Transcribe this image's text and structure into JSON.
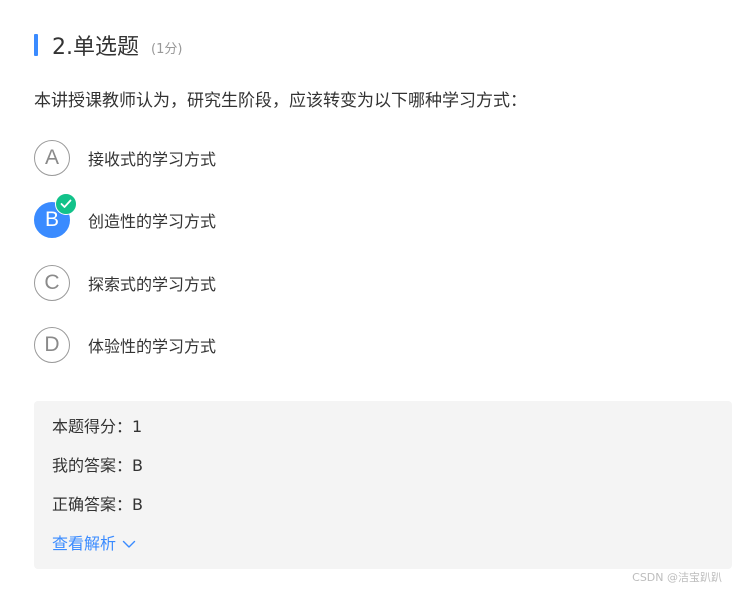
{
  "question": {
    "title": "2.单选题",
    "score": "(1分)",
    "stem": "本讲授课教师认为，研究生阶段，应该转变为以下哪种学习方式：",
    "options": [
      {
        "letter": "A",
        "text": "接收式的学习方式",
        "selected": false
      },
      {
        "letter": "B",
        "text": "创造性的学习方式",
        "selected": true
      },
      {
        "letter": "C",
        "text": "探索式的学习方式",
        "selected": false
      },
      {
        "letter": "D",
        "text": "体验性的学习方式",
        "selected": false
      }
    ]
  },
  "result": {
    "score_line": "本题得分：1",
    "my_answer_line": "我的答案：B",
    "correct_answer_line": "正确答案：B",
    "analysis_link": "查看解析"
  },
  "icons": {
    "check": "check-icon",
    "chevron": "chevron-down-icon"
  },
  "colors": {
    "accent": "#3A8BFF",
    "correct": "#12C28A",
    "panel_bg": "#F4F4F4"
  },
  "watermark": "CSDN @洁宝趴趴"
}
